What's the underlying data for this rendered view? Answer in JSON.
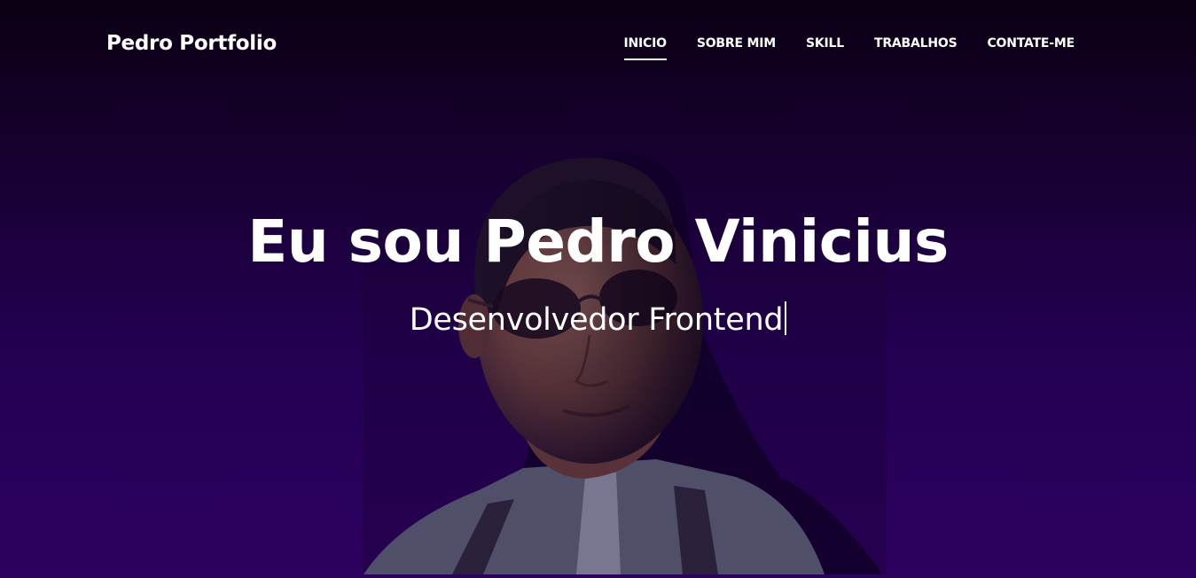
{
  "navbar": {
    "brand": "Pedro Portfolio",
    "links": [
      {
        "label": "INICIO",
        "active": true
      },
      {
        "label": "SOBRE MIM",
        "active": false
      },
      {
        "label": "SKILL",
        "active": false
      },
      {
        "label": "TRABALHOS",
        "active": false
      },
      {
        "label": "CONTATE-ME",
        "active": false
      }
    ]
  },
  "hero": {
    "title": "Eu sou Pedro Vinicius",
    "subtitle": "Desenvolvedor Frontend"
  },
  "colors": {
    "background_top": "#0b0013",
    "background_bottom": "#2d015f",
    "text": "#ffffff"
  }
}
